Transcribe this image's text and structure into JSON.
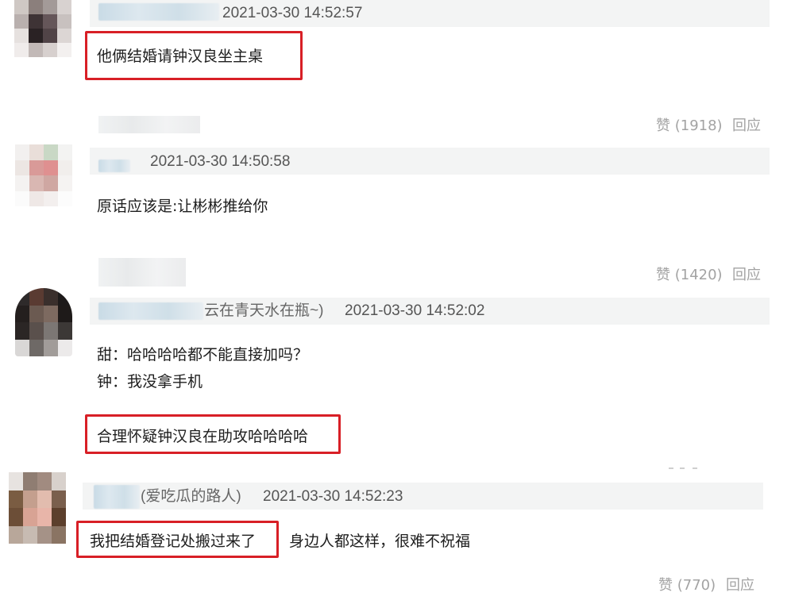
{
  "comments": [
    {
      "timestamp": "2021-03-30 14:52:57",
      "text": "他俩结婚请钟汉良坐主桌"
    },
    {
      "actions": {
        "like": "赞 (1918)",
        "reply": "回应"
      }
    },
    {
      "timestamp": "2021-03-30 14:50:58",
      "text": "原话应该是:让彬彬推给你"
    },
    {
      "actions": {
        "like": "赞 (1420)",
        "reply": "回应"
      }
    },
    {
      "nickname": "云在青天水在瓶~)",
      "timestamp": "2021-03-30 14:52:02",
      "lines": [
        "甜：哈哈哈哈都不能直接加吗？",
        "钟：我没拿手机"
      ],
      "highlight": "合理怀疑钟汉良在助攻哈哈哈哈"
    },
    {
      "nickname": "(爱吃瓜的路人)",
      "timestamp": "2021-03-30 14:52:23",
      "highlight": "我把结婚登记处搬过来了",
      "text_after": "身边人都这样，很难不祝福",
      "actions": {
        "like": "赞 (770)",
        "reply": "回应"
      }
    }
  ],
  "colors": {
    "highlight_border": "#d81f26",
    "meta_background": "#f3f4f4",
    "action_text": "#a3a3a3"
  }
}
